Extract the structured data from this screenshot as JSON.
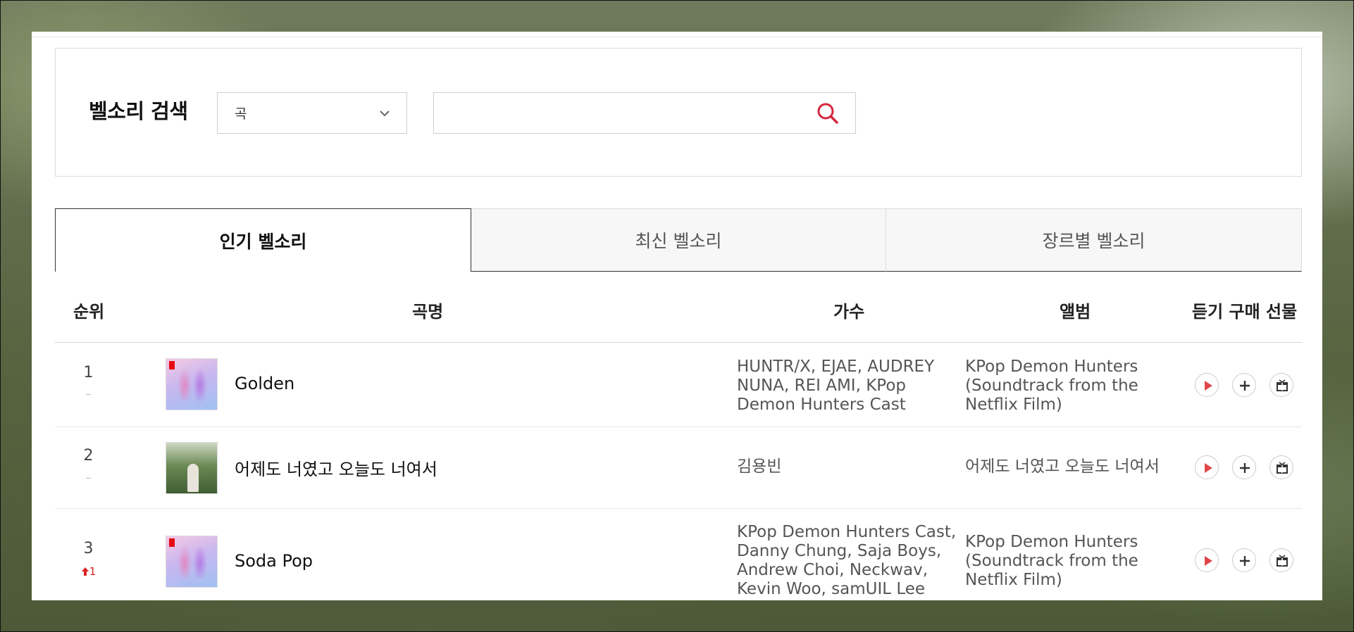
{
  "search": {
    "title": "벨소리 검색",
    "category_selected": "곡",
    "input_value": "",
    "input_placeholder": ""
  },
  "tabs": [
    {
      "label": "인기 벨소리",
      "active": true
    },
    {
      "label": "최신 벨소리",
      "active": false
    },
    {
      "label": "장르별 벨소리",
      "active": false
    }
  ],
  "table": {
    "headers": {
      "rank": "순위",
      "title": "곡명",
      "artist": "가수",
      "album": "앨범",
      "actions": "듣기 구매 선물"
    },
    "rows": [
      {
        "rank": "1",
        "change": "–",
        "title": "Golden",
        "artist": "HUNTR/X, EJAE, AUDREY NUNA, REI AMI, KPop Demon Hunters Cast",
        "album": "KPop Demon Hunters (Soundtrack from the Netflix Film)",
        "thumb_icon": "album-cover-kpop-demon-hunters"
      },
      {
        "rank": "2",
        "change": "–",
        "title": "어제도 너였고 오늘도 너여서",
        "artist": "김용빈",
        "album": "어제도 너였고 오늘도 너여서",
        "thumb_icon": "album-cover-green"
      },
      {
        "rank": "3",
        "change": "1",
        "change_direction": "up",
        "title": "Soda Pop",
        "artist": "KPop Demon Hunters Cast, Danny Chung, Saja Boys, Andrew Choi, Neckwav, Kevin Woo, samUIL Lee",
        "album": "KPop Demon Hunters (Soundtrack from the Netflix Film)",
        "thumb_icon": "album-cover-kpop-demon-hunters"
      }
    ]
  },
  "colors": {
    "accent_red": "#d7263d",
    "rank_up": "#dd2222",
    "tab_active_border": "#333333"
  },
  "icons": [
    "chevron-down-icon",
    "search-icon",
    "play-icon",
    "plus-icon",
    "gift-icon",
    "arrow-up-icon"
  ]
}
